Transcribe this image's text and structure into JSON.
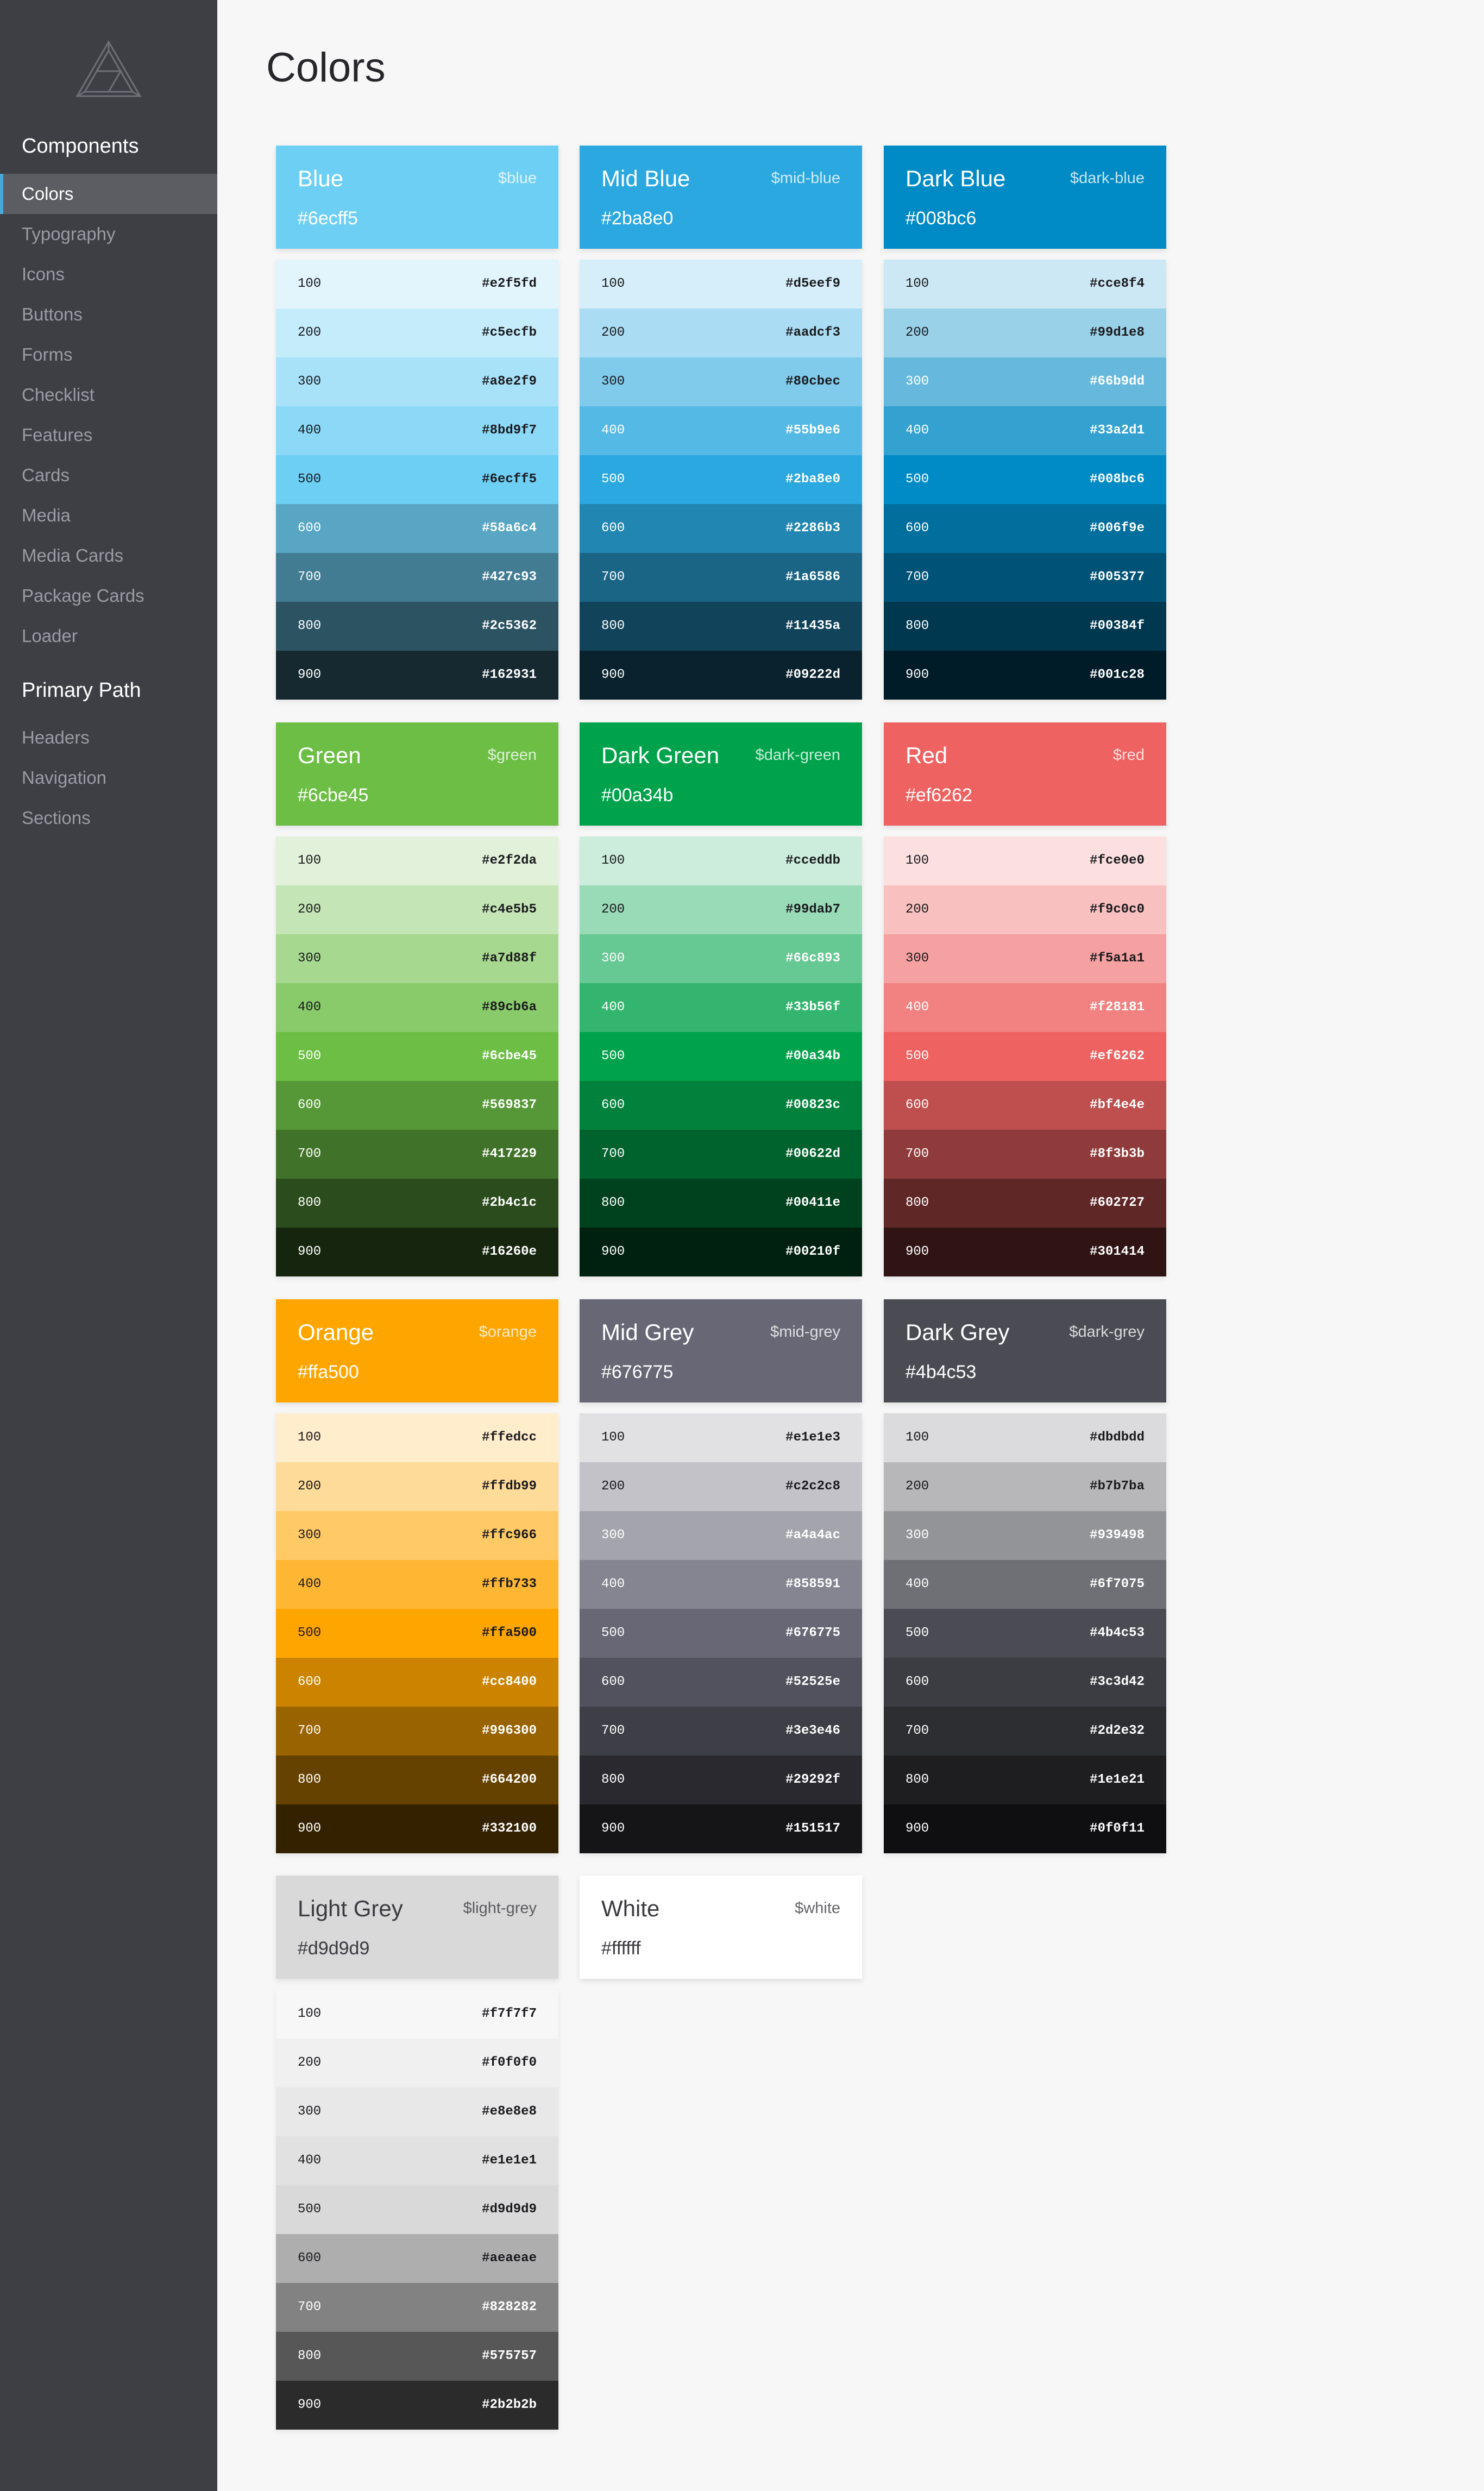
{
  "sidebar": {
    "logo_icon": "impossible-triangle-logo",
    "sections": [
      {
        "heading": "Components",
        "items": [
          {
            "label": "Colors",
            "active": true
          },
          {
            "label": "Typography"
          },
          {
            "label": "Icons"
          },
          {
            "label": "Buttons"
          },
          {
            "label": "Forms"
          },
          {
            "label": "Checklist"
          },
          {
            "label": "Features"
          },
          {
            "label": "Cards"
          },
          {
            "label": "Media"
          },
          {
            "label": "Media Cards"
          },
          {
            "label": "Package Cards"
          },
          {
            "label": "Loader"
          }
        ]
      },
      {
        "heading": "Primary Path",
        "items": [
          {
            "label": "Headers"
          },
          {
            "label": "Navigation"
          },
          {
            "label": "Sections"
          }
        ]
      }
    ]
  },
  "main": {
    "title": "Colors",
    "palettes": [
      {
        "name": "Blue",
        "var": "$blue",
        "hex": "#6ecff5",
        "text": "#ffffff",
        "shades": [
          [
            "100",
            "#e2f5fd"
          ],
          [
            "200",
            "#c5ecfb"
          ],
          [
            "300",
            "#a8e2f9"
          ],
          [
            "400",
            "#8bd9f7"
          ],
          [
            "500",
            "#6ecff5"
          ],
          [
            "600",
            "#58a6c4"
          ],
          [
            "700",
            "#427c93"
          ],
          [
            "800",
            "#2c5362"
          ],
          [
            "900",
            "#162931"
          ]
        ]
      },
      {
        "name": "Mid Blue",
        "var": "$mid-blue",
        "hex": "#2ba8e0",
        "text": "#ffffff",
        "shades": [
          [
            "100",
            "#d5eef9"
          ],
          [
            "200",
            "#aadcf3"
          ],
          [
            "300",
            "#80cbec"
          ],
          [
            "400",
            "#55b9e6"
          ],
          [
            "500",
            "#2ba8e0"
          ],
          [
            "600",
            "#2286b3"
          ],
          [
            "700",
            "#1a6586"
          ],
          [
            "800",
            "#11435a"
          ],
          [
            "900",
            "#09222d"
          ]
        ]
      },
      {
        "name": "Dark Blue",
        "var": "$dark-blue",
        "hex": "#008bc6",
        "text": "#ffffff",
        "shades": [
          [
            "100",
            "#cce8f4"
          ],
          [
            "200",
            "#99d1e8"
          ],
          [
            "300",
            "#66b9dd"
          ],
          [
            "400",
            "#33a2d1"
          ],
          [
            "500",
            "#008bc6"
          ],
          [
            "600",
            "#006f9e"
          ],
          [
            "700",
            "#005377"
          ],
          [
            "800",
            "#00384f"
          ],
          [
            "900",
            "#001c28"
          ]
        ]
      },
      {
        "name": "Green",
        "var": "$green",
        "hex": "#6cbe45",
        "text": "#ffffff",
        "shades": [
          [
            "100",
            "#e2f2da"
          ],
          [
            "200",
            "#c4e5b5"
          ],
          [
            "300",
            "#a7d88f"
          ],
          [
            "400",
            "#89cb6a"
          ],
          [
            "500",
            "#6cbe45"
          ],
          [
            "600",
            "#569837"
          ],
          [
            "700",
            "#417229"
          ],
          [
            "800",
            "#2b4c1c"
          ],
          [
            "900",
            "#16260e"
          ]
        ]
      },
      {
        "name": "Dark Green",
        "var": "$dark-green",
        "hex": "#00a34b",
        "text": "#ffffff",
        "shades": [
          [
            "100",
            "#cceddb"
          ],
          [
            "200",
            "#99dab7"
          ],
          [
            "300",
            "#66c893"
          ],
          [
            "400",
            "#33b56f"
          ],
          [
            "500",
            "#00a34b"
          ],
          [
            "600",
            "#00823c"
          ],
          [
            "700",
            "#00622d"
          ],
          [
            "800",
            "#00411e"
          ],
          [
            "900",
            "#00210f"
          ]
        ]
      },
      {
        "name": "Red",
        "var": "$red",
        "hex": "#ef6262",
        "text": "#ffffff",
        "shades": [
          [
            "100",
            "#fce0e0"
          ],
          [
            "200",
            "#f9c0c0"
          ],
          [
            "300",
            "#f5a1a1"
          ],
          [
            "400",
            "#f28181"
          ],
          [
            "500",
            "#ef6262"
          ],
          [
            "600",
            "#bf4e4e"
          ],
          [
            "700",
            "#8f3b3b"
          ],
          [
            "800",
            "#602727"
          ],
          [
            "900",
            "#301414"
          ]
        ]
      },
      {
        "name": "Orange",
        "var": "$orange",
        "hex": "#ffa500",
        "text": "#ffffff",
        "shades": [
          [
            "100",
            "#ffedcc"
          ],
          [
            "200",
            "#ffdb99"
          ],
          [
            "300",
            "#ffc966"
          ],
          [
            "400",
            "#ffb733"
          ],
          [
            "500",
            "#ffa500"
          ],
          [
            "600",
            "#cc8400"
          ],
          [
            "700",
            "#996300"
          ],
          [
            "800",
            "#664200"
          ],
          [
            "900",
            "#332100"
          ]
        ]
      },
      {
        "name": "Mid Grey",
        "var": "$mid-grey",
        "hex": "#676775",
        "text": "#ffffff",
        "shades": [
          [
            "100",
            "#e1e1e3"
          ],
          [
            "200",
            "#c2c2c8"
          ],
          [
            "300",
            "#a4a4ac"
          ],
          [
            "400",
            "#858591"
          ],
          [
            "500",
            "#676775"
          ],
          [
            "600",
            "#52525e"
          ],
          [
            "700",
            "#3e3e46"
          ],
          [
            "800",
            "#29292f"
          ],
          [
            "900",
            "#151517"
          ]
        ]
      },
      {
        "name": "Dark Grey",
        "var": "$dark-grey",
        "hex": "#4b4c53",
        "text": "#ffffff",
        "shades": [
          [
            "100",
            "#dbdbdd"
          ],
          [
            "200",
            "#b7b7ba"
          ],
          [
            "300",
            "#939498"
          ],
          [
            "400",
            "#6f7075"
          ],
          [
            "500",
            "#4b4c53"
          ],
          [
            "600",
            "#3c3d42"
          ],
          [
            "700",
            "#2d2e32"
          ],
          [
            "800",
            "#1e1e21"
          ],
          [
            "900",
            "#0f0f11"
          ]
        ]
      },
      {
        "name": "Light Grey",
        "var": "$light-grey",
        "hex": "#d9d9d9",
        "text": "#3a3a40",
        "shades": [
          [
            "100",
            "#f7f7f7"
          ],
          [
            "200",
            "#f0f0f0"
          ],
          [
            "300",
            "#e8e8e8"
          ],
          [
            "400",
            "#e1e1e1"
          ],
          [
            "500",
            "#d9d9d9"
          ],
          [
            "600",
            "#aeaeae"
          ],
          [
            "700",
            "#828282"
          ],
          [
            "800",
            "#575757"
          ],
          [
            "900",
            "#2b2b2b"
          ]
        ]
      },
      {
        "name": "White",
        "var": "$white",
        "hex": "#ffffff",
        "text": "#3a3a40",
        "shades": []
      }
    ]
  }
}
